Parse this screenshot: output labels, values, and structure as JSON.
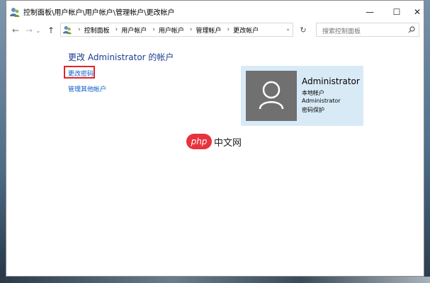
{
  "window": {
    "title": "控制面板\\用户帐户\\用户帐户\\管理帐户\\更改帐户",
    "controls": {
      "minimize": "—",
      "maximize": "☐",
      "close": "✕"
    }
  },
  "navigation": {
    "back": "←",
    "forward": "→",
    "recent": "⌄",
    "up": "↑",
    "refresh": "↻"
  },
  "address_bar": {
    "breadcrumbs": [
      "控制面板",
      "用户帐户",
      "用户帐户",
      "管理帐户",
      "更改帐户"
    ],
    "separator": "›",
    "dropdown": "⌄"
  },
  "search": {
    "placeholder": "搜索控制面板"
  },
  "main": {
    "heading": "更改 Administrator 的帐户",
    "links": {
      "change_password": "更改密码",
      "manage_other_accounts": "管理其他帐户"
    }
  },
  "account": {
    "name": "Administrator",
    "type": "本地帐户",
    "username": "Administrator",
    "status": "密码保护"
  },
  "watermark": {
    "logo": "php",
    "text": "中文网"
  },
  "colors": {
    "heading": "#1e3c90",
    "link": "#0b5ec8",
    "highlight_box": "#e0242a",
    "card_bg": "#d9eaf7",
    "avatar_bg": "#707070",
    "watermark_red": "#e8323c"
  }
}
